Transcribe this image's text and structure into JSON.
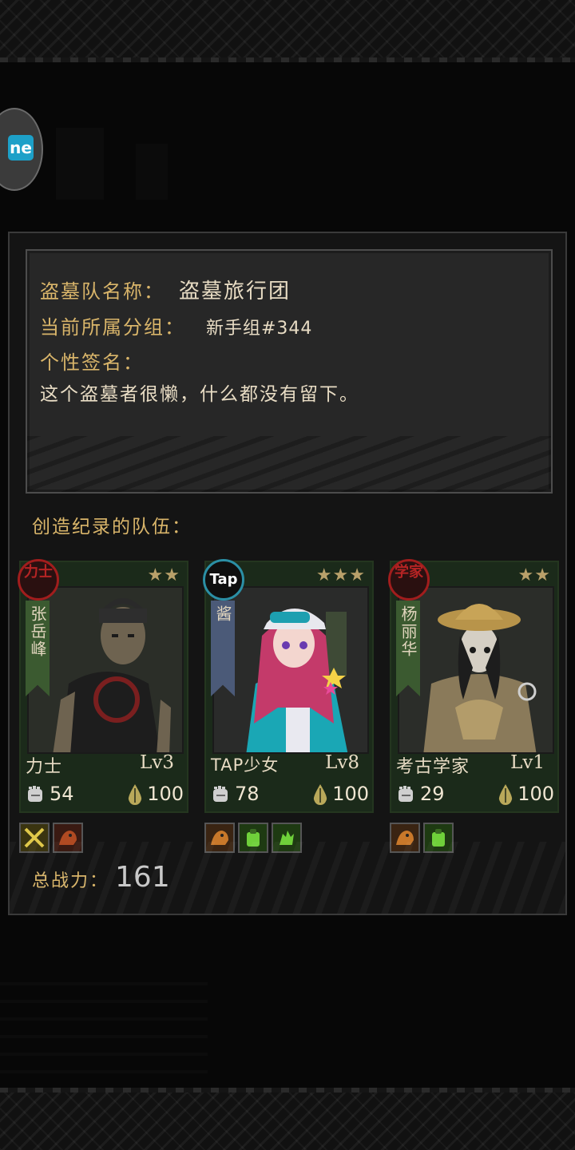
{
  "header": {
    "corner_badge_text": "ne"
  },
  "team_info": {
    "name_label": "盗墓队名称：",
    "name_value": "盗墓旅行团",
    "group_label": "当前所属分组：",
    "group_value": "新手组#344",
    "signature_label": "个性签名：",
    "signature_value": "这个盗墓者很懒，什么都没有留下。"
  },
  "record_team_title": "创造纪录的队伍：",
  "members": [
    {
      "emblem": "力士",
      "emblem_style": "red",
      "name": "张岳峰",
      "banner_color": "green",
      "stars": "★★",
      "class_name": "力士",
      "level": "Lv3",
      "power": "54",
      "water": "100",
      "skills": [
        "slash-skill-icon",
        "beast-skill-icon"
      ]
    },
    {
      "emblem": "Tap",
      "emblem_style": "tap",
      "name": "酱",
      "banner_color": "blue",
      "stars": "★★★",
      "class_name": "TAP少女",
      "level": "Lv8",
      "power": "78",
      "water": "100",
      "skills": [
        "beast-skill-icon",
        "backpack-skill-icon",
        "hand-skill-icon"
      ]
    },
    {
      "emblem": "学家",
      "emblem_style": "red",
      "name": "杨丽华",
      "banner_color": "green",
      "stars": "★★",
      "class_name": "考古学家",
      "level": "Lv1",
      "power": "29",
      "water": "100",
      "skills": [
        "beast-skill-icon",
        "backpack-skill-icon"
      ]
    }
  ],
  "total_power_label": "总战力：",
  "total_power_value": "161",
  "colors": {
    "gold_label": "#d9b56a",
    "panel": "#141414",
    "card_green": "#1b2a1a"
  }
}
